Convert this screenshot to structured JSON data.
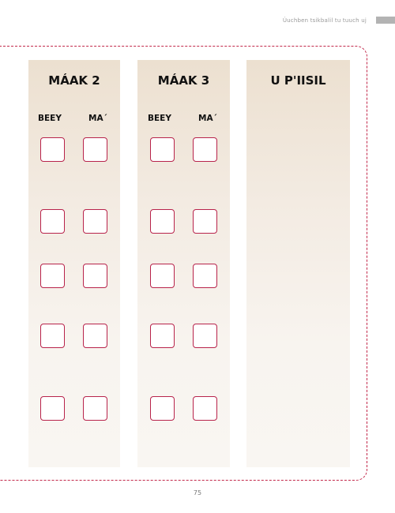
{
  "header": {
    "running_title": "Úuchben tsikbalil tu tuuch uj"
  },
  "columns": [
    {
      "title": "MÁAK 2",
      "labels": [
        "BEEY",
        "MA´"
      ]
    },
    {
      "title": "MÁAK 3",
      "labels": [
        "BEEY",
        "MA´"
      ]
    },
    {
      "title": "U P'IISIL",
      "labels": []
    }
  ],
  "page_number": "75",
  "colors": {
    "frame": "#c2284a",
    "checkbox_border": "#b8234b",
    "column_top": "#ece0d0",
    "column_bottom": "#f9f6f2"
  }
}
